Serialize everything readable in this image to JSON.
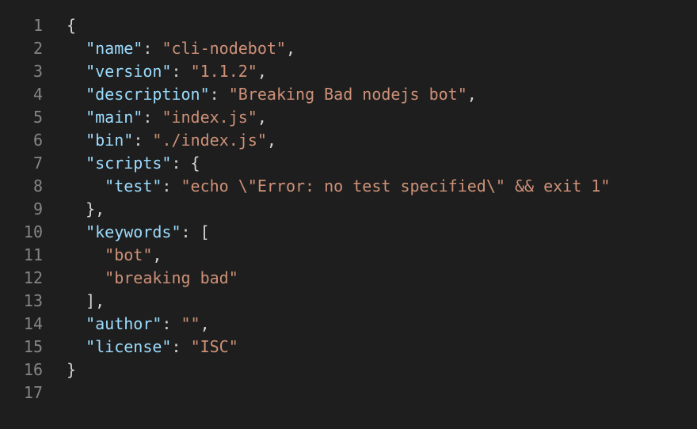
{
  "colors": {
    "background": "#1e1e1e",
    "line_number": "#858585",
    "key": "#9cdcfe",
    "string": "#ce9178",
    "punctuation": "#d4d4d4"
  },
  "lines": [
    {
      "n": "1",
      "tokens": [
        {
          "t": "{",
          "k": "pun"
        }
      ]
    },
    {
      "n": "2",
      "tokens": [
        {
          "t": "  ",
          "k": "pun"
        },
        {
          "t": "\"name\"",
          "k": "key"
        },
        {
          "t": ": ",
          "k": "pun"
        },
        {
          "t": "\"cli-nodebot\"",
          "k": "str"
        },
        {
          "t": ",",
          "k": "pun"
        }
      ]
    },
    {
      "n": "3",
      "tokens": [
        {
          "t": "  ",
          "k": "pun"
        },
        {
          "t": "\"version\"",
          "k": "key"
        },
        {
          "t": ": ",
          "k": "pun"
        },
        {
          "t": "\"1.1.2\"",
          "k": "str"
        },
        {
          "t": ",",
          "k": "pun"
        }
      ]
    },
    {
      "n": "4",
      "tokens": [
        {
          "t": "  ",
          "k": "pun"
        },
        {
          "t": "\"description\"",
          "k": "key"
        },
        {
          "t": ": ",
          "k": "pun"
        },
        {
          "t": "\"Breaking Bad nodejs bot\"",
          "k": "str"
        },
        {
          "t": ",",
          "k": "pun"
        }
      ]
    },
    {
      "n": "5",
      "tokens": [
        {
          "t": "  ",
          "k": "pun"
        },
        {
          "t": "\"main\"",
          "k": "key"
        },
        {
          "t": ": ",
          "k": "pun"
        },
        {
          "t": "\"index.js\"",
          "k": "str"
        },
        {
          "t": ",",
          "k": "pun"
        }
      ]
    },
    {
      "n": "6",
      "tokens": [
        {
          "t": "  ",
          "k": "pun"
        },
        {
          "t": "\"bin\"",
          "k": "key"
        },
        {
          "t": ": ",
          "k": "pun"
        },
        {
          "t": "\"./index.js\"",
          "k": "str"
        },
        {
          "t": ",",
          "k": "pun"
        }
      ]
    },
    {
      "n": "7",
      "tokens": [
        {
          "t": "  ",
          "k": "pun"
        },
        {
          "t": "\"scripts\"",
          "k": "key"
        },
        {
          "t": ": {",
          "k": "pun"
        }
      ]
    },
    {
      "n": "8",
      "tokens": [
        {
          "t": "    ",
          "k": "pun"
        },
        {
          "t": "\"test\"",
          "k": "key"
        },
        {
          "t": ": ",
          "k": "pun"
        },
        {
          "t": "\"echo \\\"Error: no test specified\\\" && exit 1\"",
          "k": "str"
        }
      ]
    },
    {
      "n": "9",
      "tokens": [
        {
          "t": "  },",
          "k": "pun"
        }
      ]
    },
    {
      "n": "10",
      "tokens": [
        {
          "t": "  ",
          "k": "pun"
        },
        {
          "t": "\"keywords\"",
          "k": "key"
        },
        {
          "t": ": [",
          "k": "pun"
        }
      ]
    },
    {
      "n": "11",
      "tokens": [
        {
          "t": "    ",
          "k": "pun"
        },
        {
          "t": "\"bot\"",
          "k": "str"
        },
        {
          "t": ",",
          "k": "pun"
        }
      ]
    },
    {
      "n": "12",
      "tokens": [
        {
          "t": "    ",
          "k": "pun"
        },
        {
          "t": "\"breaking bad\"",
          "k": "str"
        }
      ]
    },
    {
      "n": "13",
      "tokens": [
        {
          "t": "  ],",
          "k": "pun"
        }
      ]
    },
    {
      "n": "14",
      "tokens": [
        {
          "t": "  ",
          "k": "pun"
        },
        {
          "t": "\"author\"",
          "k": "key"
        },
        {
          "t": ": ",
          "k": "pun"
        },
        {
          "t": "\"\"",
          "k": "str"
        },
        {
          "t": ",",
          "k": "pun"
        }
      ]
    },
    {
      "n": "15",
      "tokens": [
        {
          "t": "  ",
          "k": "pun"
        },
        {
          "t": "\"license\"",
          "k": "key"
        },
        {
          "t": ": ",
          "k": "pun"
        },
        {
          "t": "\"ISC\"",
          "k": "str"
        }
      ]
    },
    {
      "n": "16",
      "tokens": [
        {
          "t": "}",
          "k": "pun"
        }
      ]
    },
    {
      "n": "17",
      "tokens": []
    }
  ]
}
